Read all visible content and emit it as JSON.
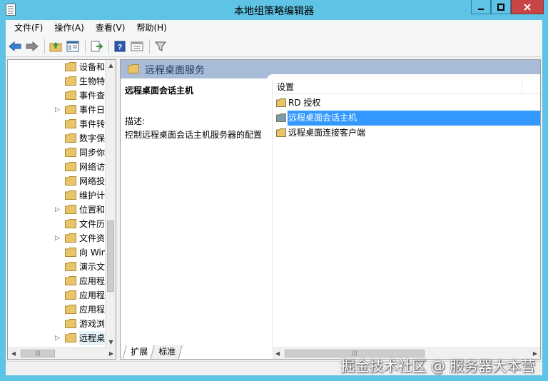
{
  "window": {
    "title": "本地组策略编辑器"
  },
  "menu": {
    "items": [
      "文件(F)",
      "操作(A)",
      "查看(V)",
      "帮助(H)"
    ]
  },
  "toolbar": {
    "buttons": [
      "back-icon",
      "forward-icon",
      "up-folder-icon",
      "show-hide-tree-icon",
      "export-list-icon",
      "help-icon",
      "properties-icon",
      "filter-icon"
    ]
  },
  "tree": {
    "items": [
      {
        "label": "设备和",
        "expandable": false
      },
      {
        "label": "生物特",
        "expandable": false
      },
      {
        "label": "事件查",
        "expandable": false
      },
      {
        "label": "事件日",
        "expandable": true
      },
      {
        "label": "事件转",
        "expandable": false
      },
      {
        "label": "数字保",
        "expandable": false
      },
      {
        "label": "同步你",
        "expandable": false
      },
      {
        "label": "网络访",
        "expandable": false
      },
      {
        "label": "网络投",
        "expandable": false
      },
      {
        "label": "维护计",
        "expandable": false
      },
      {
        "label": "位置和",
        "expandable": true
      },
      {
        "label": "文件历",
        "expandable": false
      },
      {
        "label": "文件资",
        "expandable": true
      },
      {
        "label": "向 Win",
        "expandable": false
      },
      {
        "label": "演示文",
        "expandable": false
      },
      {
        "label": "应用程",
        "expandable": false
      },
      {
        "label": "应用程",
        "expandable": false
      },
      {
        "label": "应用程",
        "expandable": false
      },
      {
        "label": "游戏浏",
        "expandable": false
      },
      {
        "label": "远程桌",
        "expandable": true,
        "selected": true
      }
    ]
  },
  "header": {
    "title": "远程桌面服务"
  },
  "description": {
    "title": "远程桌面会话主机",
    "label": "描述:",
    "text": "控制远程桌面会话主机服务器的配置"
  },
  "list": {
    "column": "设置",
    "rows": [
      {
        "label": "RD 授权",
        "selected": false
      },
      {
        "label": "远程桌面会话主机",
        "selected": true
      },
      {
        "label": "远程桌面连接客户端",
        "selected": false
      }
    ]
  },
  "tabs": [
    "扩展",
    "标准"
  ],
  "watermark": "掘金技术社区 @ 服务器大本营",
  "colors": {
    "titlebar": "#5fc3e6",
    "selection": "#3399ff",
    "header": "#a8bcd8",
    "folder": "#e8c46a"
  }
}
